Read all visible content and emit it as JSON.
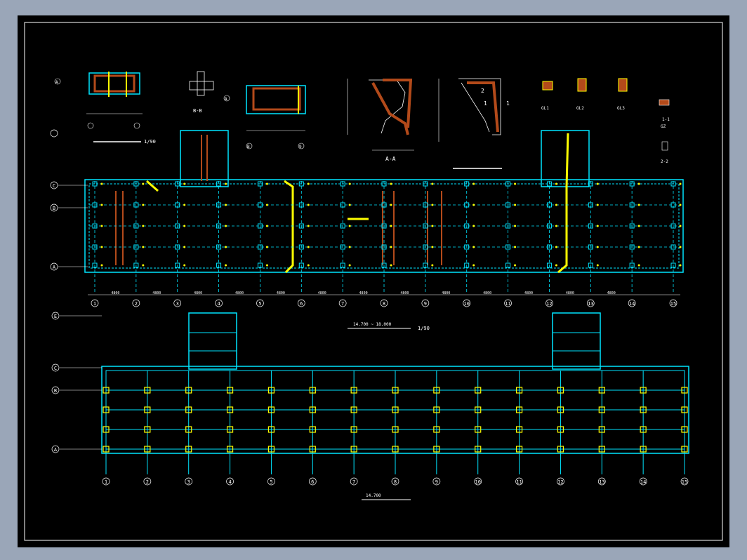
{
  "drawing": {
    "upper_plan_scale": "1/90",
    "lower_plan_title": "14.700 ~ 18.000",
    "lower_plan_scale": "1/90",
    "lower_plan_note": "14.700",
    "column_axes": [
      "1",
      "2",
      "3",
      "4",
      "5",
      "6",
      "7",
      "8",
      "9",
      "10",
      "11",
      "12",
      "13",
      "14",
      "15"
    ],
    "row_axes_upper": [
      "C",
      "B",
      "A"
    ],
    "row_axes_lower": [
      "E",
      "C",
      "B",
      "A"
    ],
    "span_dims_upper": [
      "4800",
      "4800",
      "4800",
      "4800",
      "4800",
      "4800",
      "4800",
      "4800",
      "4800",
      "4800",
      "4800",
      "4800",
      "4800"
    ],
    "section_labels": {
      "detail_bb": "B-B",
      "detail_aa": "A-A",
      "gl1": "GL1",
      "gl2": "GL2",
      "gl3": "GL3",
      "gz": "GZ",
      "sec22": "2-2",
      "sec11": "1-1"
    },
    "detail_nums": {
      "n1": "1",
      "n2": "2",
      "n3": "1"
    },
    "grid_refs": {
      "a": "A",
      "b": "B",
      "c": "C",
      "d": "9"
    }
  }
}
